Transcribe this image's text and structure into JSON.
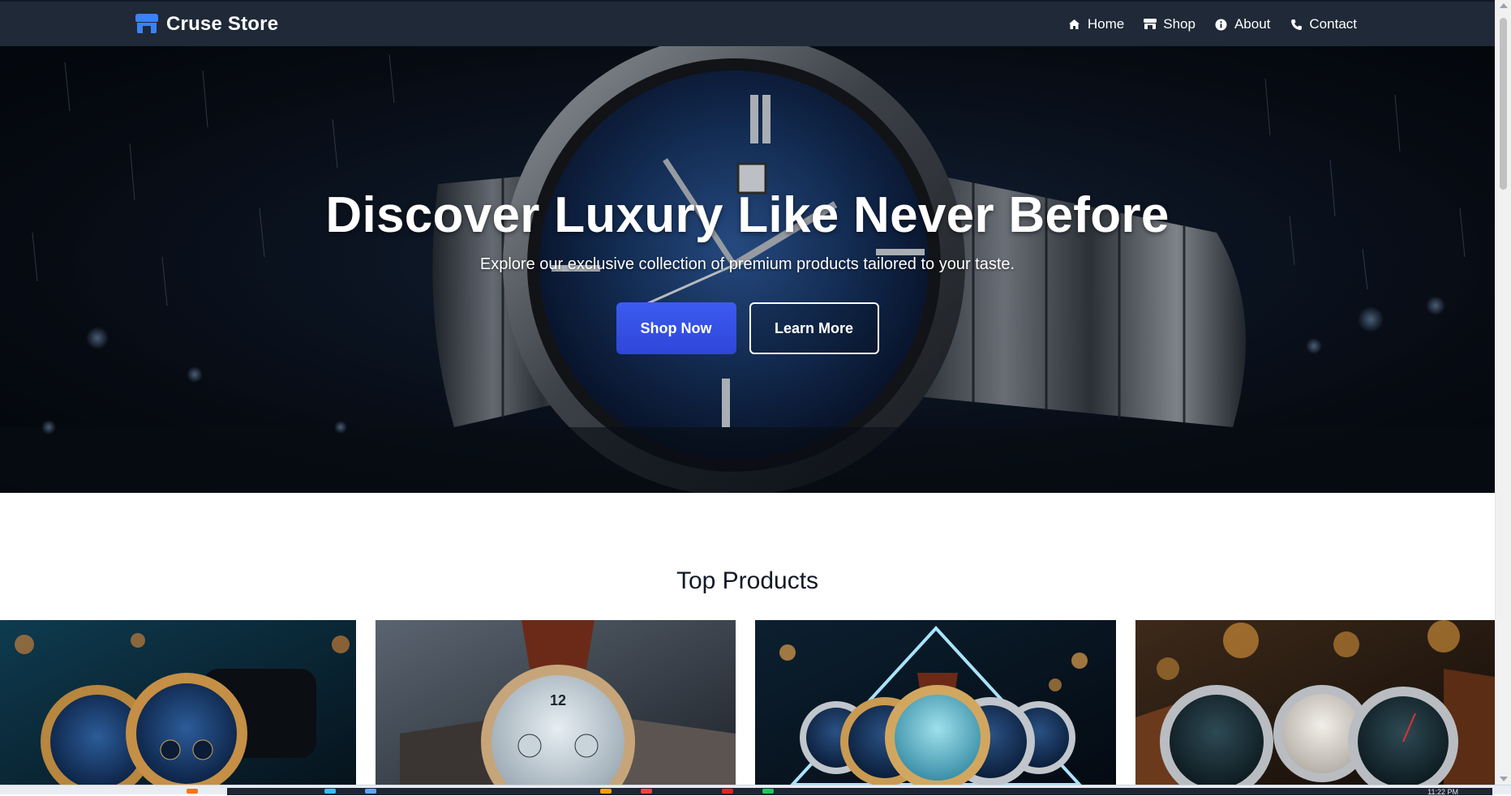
{
  "brand": {
    "name": "Cruse Store",
    "icon": "store-icon",
    "accent": "#3b82f6"
  },
  "nav": {
    "items": [
      {
        "label": "Home",
        "icon": "home-icon"
      },
      {
        "label": "Shop",
        "icon": "store-icon"
      },
      {
        "label": "About",
        "icon": "info-circle-icon"
      },
      {
        "label": "Contact",
        "icon": "phone-icon"
      }
    ]
  },
  "hero": {
    "title": "Discover Luxury Like Never Before",
    "subtitle": "Explore our exclusive collection of premium products tailored to your taste.",
    "primary_button": "Shop Now",
    "secondary_button": "Learn More",
    "primary_color": "#3650e6"
  },
  "products": {
    "title": "Top Products",
    "items": [
      {
        "image": "watch-pair-blue-dial-image"
      },
      {
        "image": "watch-white-dial-leather-image"
      },
      {
        "image": "watch-collection-neon-image"
      },
      {
        "image": "watch-trio-amber-image"
      }
    ]
  },
  "taskbar": {
    "clock": "11:22 PM"
  }
}
